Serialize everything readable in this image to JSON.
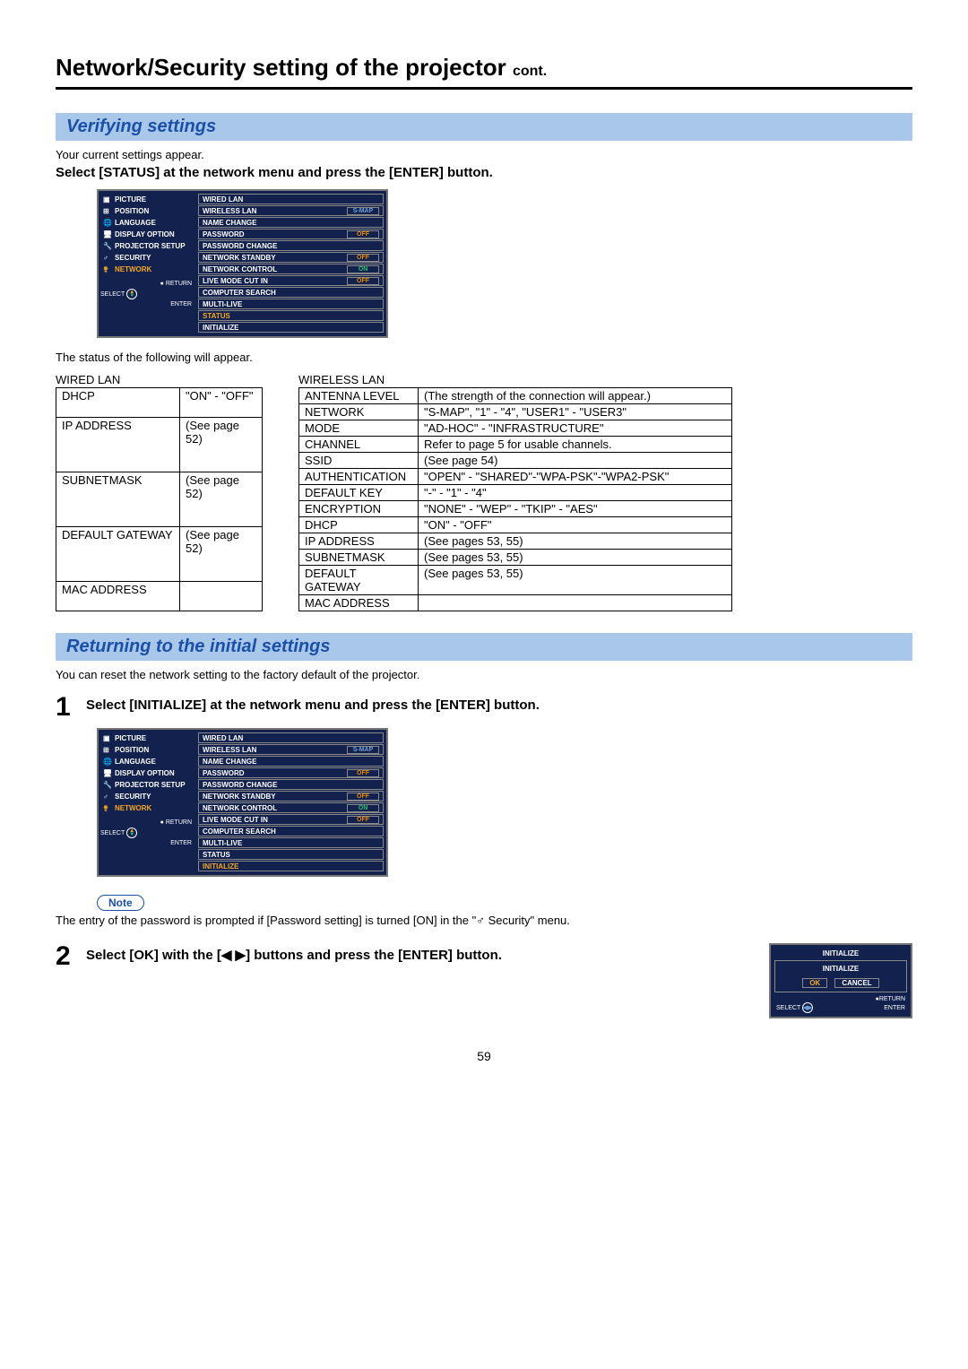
{
  "page_title": "Network/Security setting of the projector",
  "page_title_suffix": "cont.",
  "page_number": "59",
  "section1": {
    "heading": "Verifying settings",
    "intro": "Your current settings appear.",
    "instruction": "Select [STATUS] at the network menu and press the [ENTER] button.",
    "status_intro": "The status of the following will appear."
  },
  "menu": {
    "left": {
      "items": [
        {
          "label": "PICTURE",
          "icon": "▣"
        },
        {
          "label": "POSITION",
          "icon": "⊞"
        },
        {
          "label": "LANGUAGE",
          "icon": "🌐"
        },
        {
          "label": "DISPLAY OPTION",
          "icon": "🖥"
        },
        {
          "label": "PROJECTOR SETUP",
          "icon": "🔧"
        },
        {
          "label": "SECURITY",
          "icon": "♂"
        },
        {
          "label": "NETWORK",
          "icon": "⚵",
          "active": true
        }
      ],
      "return": "RETURN",
      "select": "SELECT",
      "enter": "ENTER"
    },
    "right_status": [
      {
        "label": "WIRED LAN"
      },
      {
        "label": "WIRELESS LAN",
        "val": "S-MAP",
        "cls": "smap box"
      },
      {
        "label": "NAME CHANGE"
      },
      {
        "label": "PASSWORD",
        "val": "OFF",
        "cls": "off box"
      },
      {
        "label": "PASSWORD CHANGE"
      },
      {
        "label": "NETWORK STANDBY",
        "val": "OFF",
        "cls": "off box"
      },
      {
        "label": "NETWORK CONTROL",
        "val": "ON",
        "cls": "on box"
      },
      {
        "label": "LIVE MODE CUT IN",
        "val": "OFF",
        "cls": "off box"
      },
      {
        "label": "COMPUTER SEARCH"
      },
      {
        "label": "MULTI-LIVE"
      },
      {
        "label": "STATUS",
        "highlight": "status"
      },
      {
        "label": "INITIALIZE"
      }
    ],
    "right_init": [
      {
        "label": "WIRED LAN"
      },
      {
        "label": "WIRELESS LAN",
        "val": "S-MAP",
        "cls": "smap box"
      },
      {
        "label": "NAME CHANGE"
      },
      {
        "label": "PASSWORD",
        "val": "OFF",
        "cls": "off box"
      },
      {
        "label": "PASSWORD CHANGE"
      },
      {
        "label": "NETWORK STANDBY",
        "val": "OFF",
        "cls": "off box"
      },
      {
        "label": "NETWORK CONTROL",
        "val": "ON",
        "cls": "on box"
      },
      {
        "label": "LIVE MODE CUT IN",
        "val": "OFF",
        "cls": "off box"
      },
      {
        "label": "COMPUTER SEARCH"
      },
      {
        "label": "MULTI-LIVE"
      },
      {
        "label": "STATUS"
      },
      {
        "label": "INITIALIZE",
        "highlight": "init"
      }
    ]
  },
  "wired_table": {
    "caption": "WIRED LAN",
    "rows": [
      [
        "DHCP",
        "\"ON\" - \"OFF\""
      ],
      [
        "IP ADDRESS",
        "(See page 52)"
      ],
      [
        "SUBNETMASK",
        "(See page 52)"
      ],
      [
        "DEFAULT GATEWAY",
        "(See page 52)"
      ],
      [
        "MAC ADDRESS",
        ""
      ]
    ]
  },
  "wireless_table": {
    "caption": "WIRELESS LAN",
    "rows": [
      [
        "ANTENNA LEVEL",
        "(The strength of the connection will appear.)"
      ],
      [
        "NETWORK",
        "\"S-MAP\", \"1\" - \"4\", \"USER1\" - \"USER3\""
      ],
      [
        "MODE",
        "\"AD-HOC\" - \"INFRASTRUCTURE\""
      ],
      [
        "CHANNEL",
        "Refer to page 5 for usable channels."
      ],
      [
        "SSID",
        "(See page 54)"
      ],
      [
        "AUTHENTICATION",
        "\"OPEN\" - \"SHARED\"-\"WPA-PSK\"-\"WPA2-PSK\""
      ],
      [
        "DEFAULT KEY",
        "\"-\" - \"1\" - \"4\""
      ],
      [
        "ENCRYPTION",
        "\"NONE\" - \"WEP\" - \"TKIP\" - \"AES\""
      ],
      [
        "DHCP",
        "\"ON\" - \"OFF\""
      ],
      [
        "IP ADDRESS",
        "(See pages 53, 55)"
      ],
      [
        "SUBNETMASK",
        "(See pages 53, 55)"
      ],
      [
        "DEFAULT GATEWAY",
        "(See pages 53, 55)"
      ],
      [
        "MAC ADDRESS",
        ""
      ]
    ]
  },
  "section2": {
    "heading": "Returning to the initial settings",
    "intro": "You can reset the network setting to the factory default of the projector.",
    "step1_num": "1",
    "step1_text": "Select [INITIALIZE] at the network menu and press the [ENTER] button.",
    "note_label": "Note",
    "note_text_a": "The entry of the password is prompted if [Password setting] is turned [ON] in the \"",
    "note_text_b": " Security\" menu.",
    "step2_num": "2",
    "step2_text_a": "Select [OK] with the [",
    "step2_text_b": "] buttons and press the [ENTER] button."
  },
  "init_dialog": {
    "title": "INITIALIZE",
    "subtitle": "INITIALIZE",
    "ok": "OK",
    "cancel": "CANCEL",
    "return": "RETURN",
    "select": "SELECT",
    "enter": "ENTER"
  }
}
